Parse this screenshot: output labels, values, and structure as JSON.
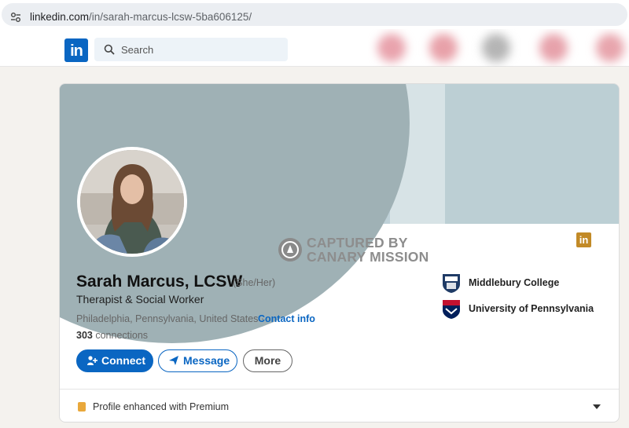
{
  "browser": {
    "url_domain": "linkedin.com",
    "url_path": "/in/sarah-marcus-lcsw-5ba606125/"
  },
  "nav": {
    "logo_text": "in",
    "search_placeholder": "Search"
  },
  "watermark": {
    "line1": "CAPTURED BY",
    "line2": "CANARY MISSION"
  },
  "profile": {
    "name": "Sarah Marcus, LCSW",
    "pronouns": "(She/Her)",
    "headline": "Therapist & Social Worker",
    "location": "Philadelphia, Pennsylvania, United States · ",
    "contact_info_label": "Contact info",
    "connections_count": "303",
    "connections_label": " connections",
    "badge_text": "in"
  },
  "actions": {
    "connect_label": "Connect",
    "message_label": "Message",
    "more_label": "More"
  },
  "education": [
    {
      "name": "Middlebury College",
      "logo": "middlebury-shield-icon"
    },
    {
      "name": "University of Pennsylvania",
      "logo": "penn-shield-icon"
    }
  ],
  "premium": {
    "label": "Profile enhanced with Premium"
  },
  "colors": {
    "linkedin_blue": "#0a66c2",
    "banner_dark": "#9fb1b5",
    "banner_light": "#bccfd4",
    "premium_gold": "#e9a83b",
    "page_bg": "#f4f2ee"
  }
}
